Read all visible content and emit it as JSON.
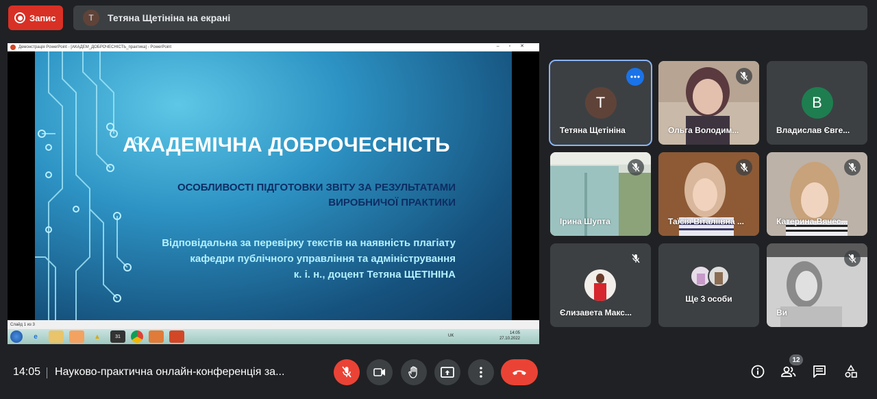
{
  "top": {
    "record_label": "Запис",
    "presenter_initial": "Т",
    "presenting_text": "Тетяна Щетініна на екрані"
  },
  "shared_screen": {
    "window_title": "Демонстрація PowerPoint - [АКАДЕМ_ДОБРОЧЕСНІСТЬ_практика] - PowerPoint",
    "slide": {
      "title": "АКАДЕМІЧНА ДОБРОЧЕСНІСТЬ",
      "subtitle_line1": "ОСОБЛИВОСТІ ПІДГОТОВКИ ЗВІТУ ЗА РЕЗУЛЬТАТАМИ",
      "subtitle_line2": "ВИРОБНИЧОЇ ПРАКТИКИ",
      "info_line1": "Відповідальна за перевірку текстів на наявність плагіату",
      "info_line2": "кафедри публічного управління та адміністрування",
      "info_line3": "к. і. н., доцент Тетяна ЩЕТІНІНА"
    },
    "status_text": "Слайд 1 из 3",
    "taskbar": {
      "lang": "UK",
      "time": "14:05",
      "date": "27.10.2022"
    }
  },
  "participants": [
    {
      "name": "Тетяна Щетініна",
      "initial": "Т",
      "avatar_color": "#5f4339"
    },
    {
      "name": "Ольга Володим..."
    },
    {
      "name": "Владислав Євге...",
      "initial": "В",
      "avatar_color": "#1e7e50"
    },
    {
      "name": "Ірина Шупта"
    },
    {
      "name": "Таїсія Віталіївна ..."
    },
    {
      "name": "Катерина Вячес..."
    },
    {
      "name": "Єлизавета Макс..."
    },
    {
      "name": "Ще 3 особи"
    },
    {
      "name": "Ви"
    }
  ],
  "bottom": {
    "time": "14:05",
    "meeting_title": "Науково-практична онлайн-конференція за...",
    "people_count": "12"
  },
  "colors": {
    "background": "#202124",
    "tile": "#3c4043",
    "danger": "#ea4335",
    "accent": "#8ab4f8"
  },
  "icons": {
    "mic": "mic-off-icon",
    "camera": "videocam-icon",
    "hand": "raise-hand-icon",
    "present": "present-icon",
    "more": "more-vert-icon",
    "hangup": "call-end-icon",
    "info": "info-icon",
    "people": "people-icon",
    "chat": "chat-icon",
    "activities": "activities-icon"
  }
}
